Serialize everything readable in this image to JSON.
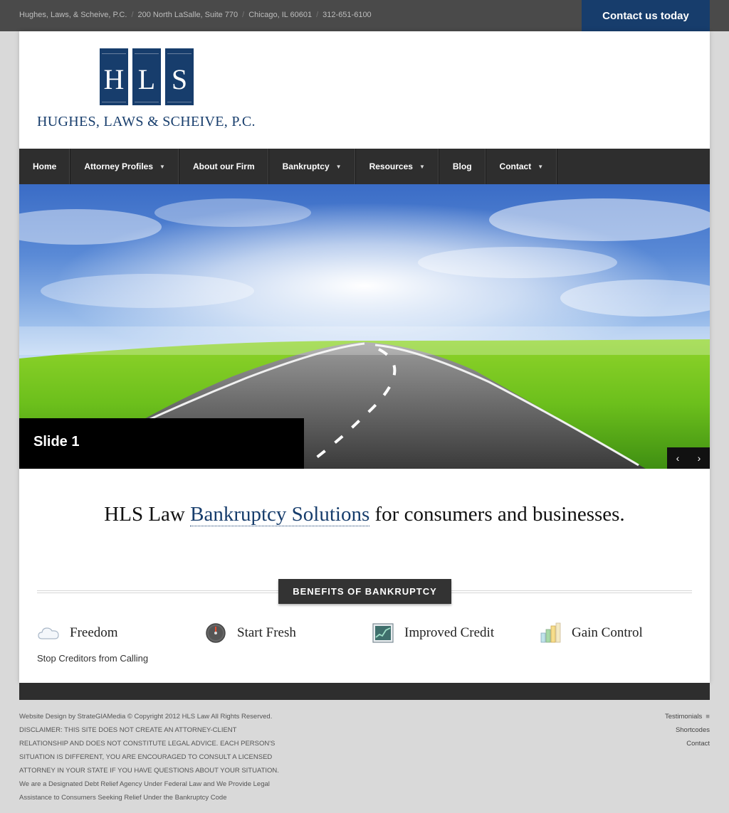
{
  "topbar": {
    "firm": "Hughes, Laws, & Scheive, P.C.",
    "address": "200 North LaSalle, Suite 770",
    "city": "Chicago, IL 60601",
    "phone": "312-651-6100",
    "separator": "/",
    "cta": "Contact us today"
  },
  "logo": {
    "letters": [
      "H",
      "L",
      "S"
    ],
    "name": "HUGHES, LAWS & SCHEIVE, P.C."
  },
  "nav": {
    "items": [
      {
        "label": "Home",
        "dropdown": false
      },
      {
        "label": "Attorney Profiles",
        "dropdown": true
      },
      {
        "label": "About our Firm",
        "dropdown": false
      },
      {
        "label": "Bankruptcy",
        "dropdown": true
      },
      {
        "label": "Resources",
        "dropdown": true
      },
      {
        "label": "Blog",
        "dropdown": false
      },
      {
        "label": "Contact",
        "dropdown": true
      }
    ]
  },
  "slider": {
    "caption": "Slide 1",
    "prev": "‹",
    "next": "›"
  },
  "tagline": {
    "before": "HLS Law ",
    "link": "Bankruptcy Solutions",
    "after": " for consumers and businesses."
  },
  "benefits": {
    "label": "BENEFITS OF BANKRUPTCY",
    "items": [
      {
        "title": "Freedom",
        "icon": "cloud-icon"
      },
      {
        "title": "Start Fresh",
        "icon": "gauge-icon"
      },
      {
        "title": "Improved Credit",
        "icon": "line-chart-icon"
      },
      {
        "title": "Gain Control",
        "icon": "bar-chart-icon"
      }
    ],
    "freedom_sub": "Stop Creditors from Calling"
  },
  "footer": {
    "left_lines": [
      "Website Design by StrateGIAMedia © Copyright 2012 HLS Law All Rights Reserved.",
      "DISCLAIMER: THIS SITE DOES NOT CREATE AN ATTORNEY-CLIENT",
      "RELATIONSHIP AND DOES NOT CONSTITUTE LEGAL ADVICE. EACH PERSON'S",
      "SITUATION IS DIFFERENT, YOU ARE ENCOURAGED TO CONSULT A LICENSED",
      "ATTORNEY IN YOUR STATE IF YOU HAVE QUESTIONS ABOUT YOUR SITUATION.",
      "We are a Designated Debt Relief Agency Under Federal Law and We Provide Legal",
      "Assistance to Consumers Seeking Relief Under the Bankruptcy Code"
    ],
    "right_links": [
      "Testimonials",
      "Shortcodes",
      "Contact"
    ]
  },
  "colors": {
    "brand": "#173d6c",
    "nav": "#2e2e2e",
    "topbar": "#4a4a4a"
  }
}
